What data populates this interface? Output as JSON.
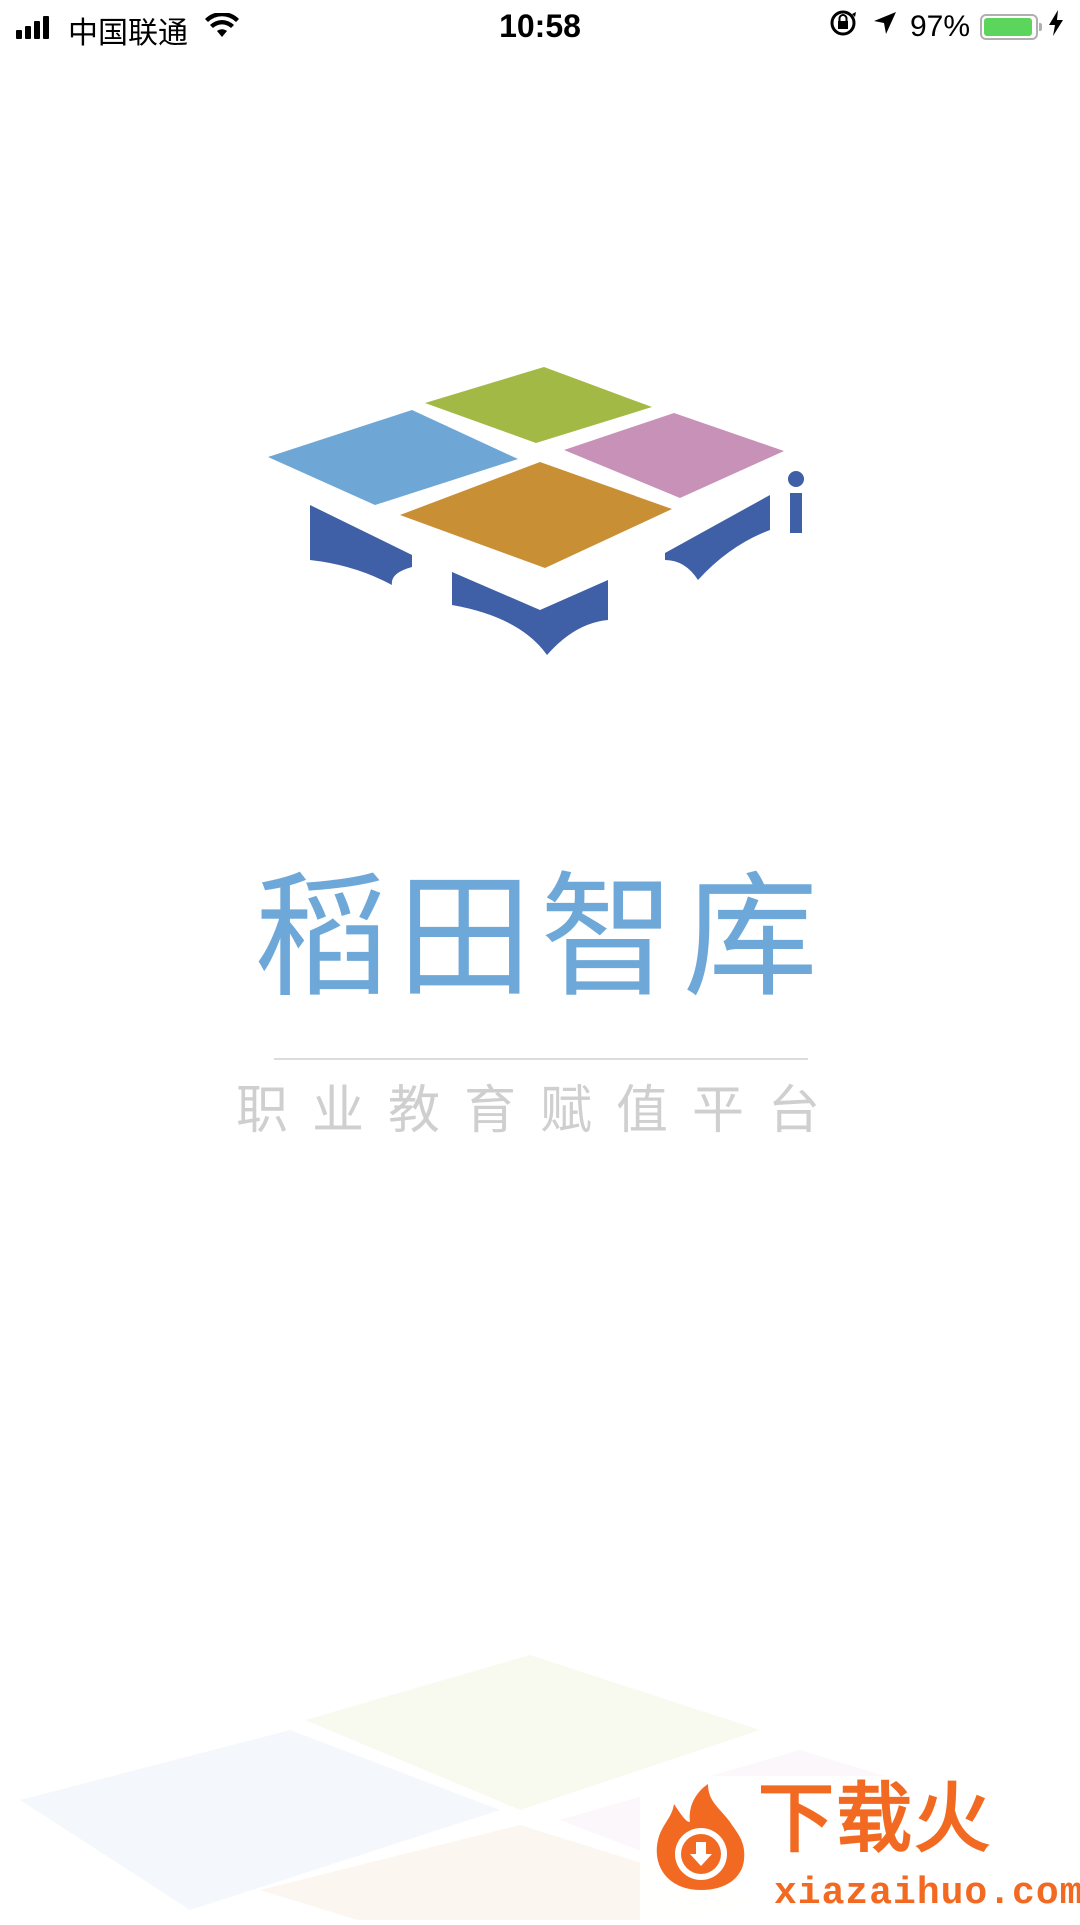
{
  "status_bar": {
    "carrier": "中国联通",
    "time": "10:58",
    "battery_percent": "97%",
    "battery_level": 0.97,
    "icons": [
      "signal-icon",
      "wifi-icon",
      "orientation-lock-icon",
      "location-arrow-icon",
      "battery-icon",
      "charging-bolt-icon"
    ]
  },
  "brand": {
    "title": "稻田智库",
    "slogan": "职业教育赋值平台",
    "colors": {
      "title": "#6ea8d8",
      "slogan": "#cfcfcf",
      "tile_blue": "#6ea7d6",
      "tile_green": "#a3b945",
      "tile_pink": "#c891b8",
      "tile_orange": "#c98f35",
      "base_navy": "#3f5fa6"
    }
  },
  "watermark": {
    "text": "下载火",
    "url": "xiazaihuo.com",
    "color": "#f26a21"
  }
}
